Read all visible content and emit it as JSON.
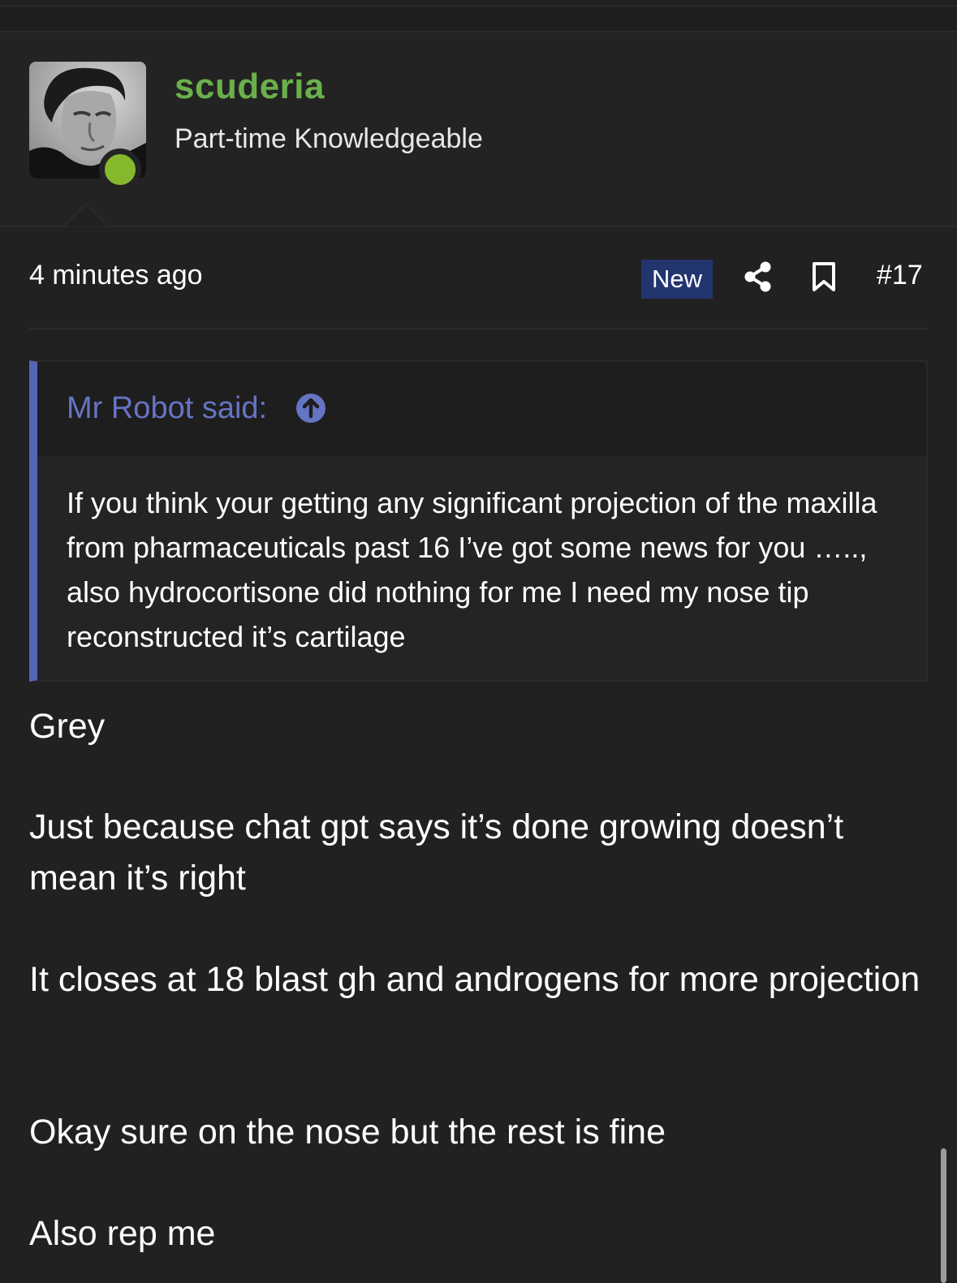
{
  "post": {
    "username": "scuderia",
    "user_title": "Part-time Knowledgeable",
    "timestamp": "4 minutes ago",
    "new_badge": "New",
    "post_number": "#17"
  },
  "quote": {
    "author": "Mr Robot said:",
    "text": "If you think your getting any significant projection of the maxilla from pharmaceuticals past 16 I’ve got some news for you ….., also hydrocortisone did nothing for me I need my nose tip reconstructed it’s cartilage"
  },
  "body": [
    "Grey",
    "Just because chat gpt says it’s done growing doesn’t mean it’s right",
    "It closes at 18 blast gh and androgens for more projection",
    "Okay sure on the nose but the rest is fine",
    "Also rep me"
  ],
  "icons": {
    "share": "share-icon",
    "bookmark": "bookmark-icon",
    "quote_jump": "arrow-up-circle-icon"
  },
  "colors": {
    "background": "#212121",
    "username": "#6ab04c",
    "online": "#86b82d",
    "badge": "#23356f",
    "quote_accent": "#5566b8"
  }
}
